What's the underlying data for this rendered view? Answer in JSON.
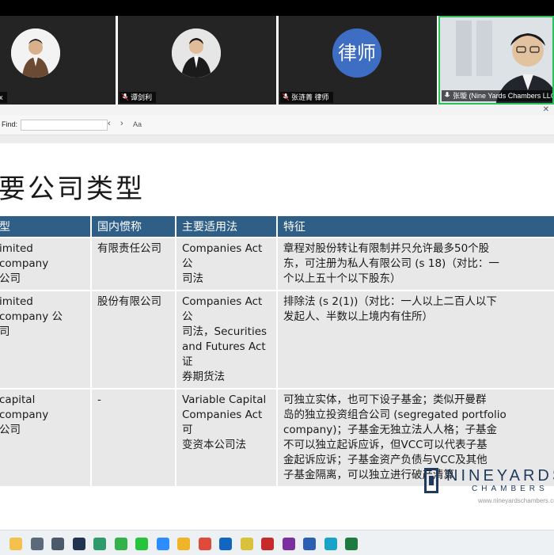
{
  "participants": [
    {
      "name": "x"
    },
    {
      "name": "谭剑利"
    },
    {
      "name": "张涟菁 律师",
      "avatar_text": "律师"
    },
    {
      "name": "张璇 (Nine Yards Chambers LLC)"
    }
  ],
  "find_bar": {
    "label": "Find:",
    "value": "",
    "prev_icon": "chevron-left-icon",
    "next_icon": "chevron-right-icon",
    "match_case_label": "Aa"
  },
  "slide": {
    "title": "要公司类型",
    "table": {
      "headers": [
        "型",
        "国内惯称",
        "主要适用法",
        "特征"
      ],
      "rows": [
        [
          "imited company\n公司",
          "有限责任公司",
          "Companies Act 公\n司法",
          "章程对股份转让有限制并只允许最多50个股\n东，可注册为私人有限公司 (s 18)（对比：一\n个以上五十个以下股东）"
        ],
        [
          "imited company 公\n司",
          "股份有限公司",
          "Companies Act 公\n司法，Securities\nand Futures Act 证\n券期货法",
          "排除法 (s 2(1))（对比：一人以上二百人以下\n发起人、半数以上境内有住所）"
        ],
        [
          "capital company\n公司",
          "-",
          "Variable Capital\nCompanies Act 可\n变资本公司法",
          "可独立实体，也可下设子基金；类似开曼群\n岛的独立投资组合公司 (segregated portfolio\ncompany)；子基金无独立法人人格；子基金\n不可以独立起诉应诉，但VCC可以代表子基\n金起诉应诉；子基金资产负债与VCC及其他\n子基金隔离，可以独立进行破产清算"
        ]
      ]
    },
    "logo": {
      "name": "NINEYARDS",
      "subtitle": "CHAMBERS LLC",
      "url": "www.nineyardschambers.com"
    }
  },
  "taskbar": {
    "icons": [
      "notes-icon",
      "clock-icon",
      "calculator-icon",
      "grid-app-icon",
      "photo-app-icon",
      "wechat-icon",
      "whatsapp-icon",
      "zoom-icon",
      "folder-icon",
      "chrome-icon",
      "outlook-icon",
      "fw-app-icon",
      "acrobat-icon",
      "onenote-icon",
      "word-icon",
      "maps-icon",
      "excel-icon"
    ],
    "colors": [
      "#f2c14e",
      "#5a6a7a",
      "#4a5a6a",
      "#22334f",
      "#2f9a6a",
      "#33b24a",
      "#25c43a",
      "#2d8cff",
      "#f0b429",
      "#e04a3a",
      "#1066c0",
      "#d9c23a",
      "#c72a2a",
      "#7b2fa0",
      "#2b5fb3",
      "#1aa3c8",
      "#1e7a3f"
    ]
  },
  "colors": {
    "table_header": "#2f5f87",
    "table_cell": "#e8e8e8",
    "active_speaker": "#2ec05a",
    "avatar_blue": "#3d6ec4",
    "logo_navy": "#1f3a5c"
  }
}
